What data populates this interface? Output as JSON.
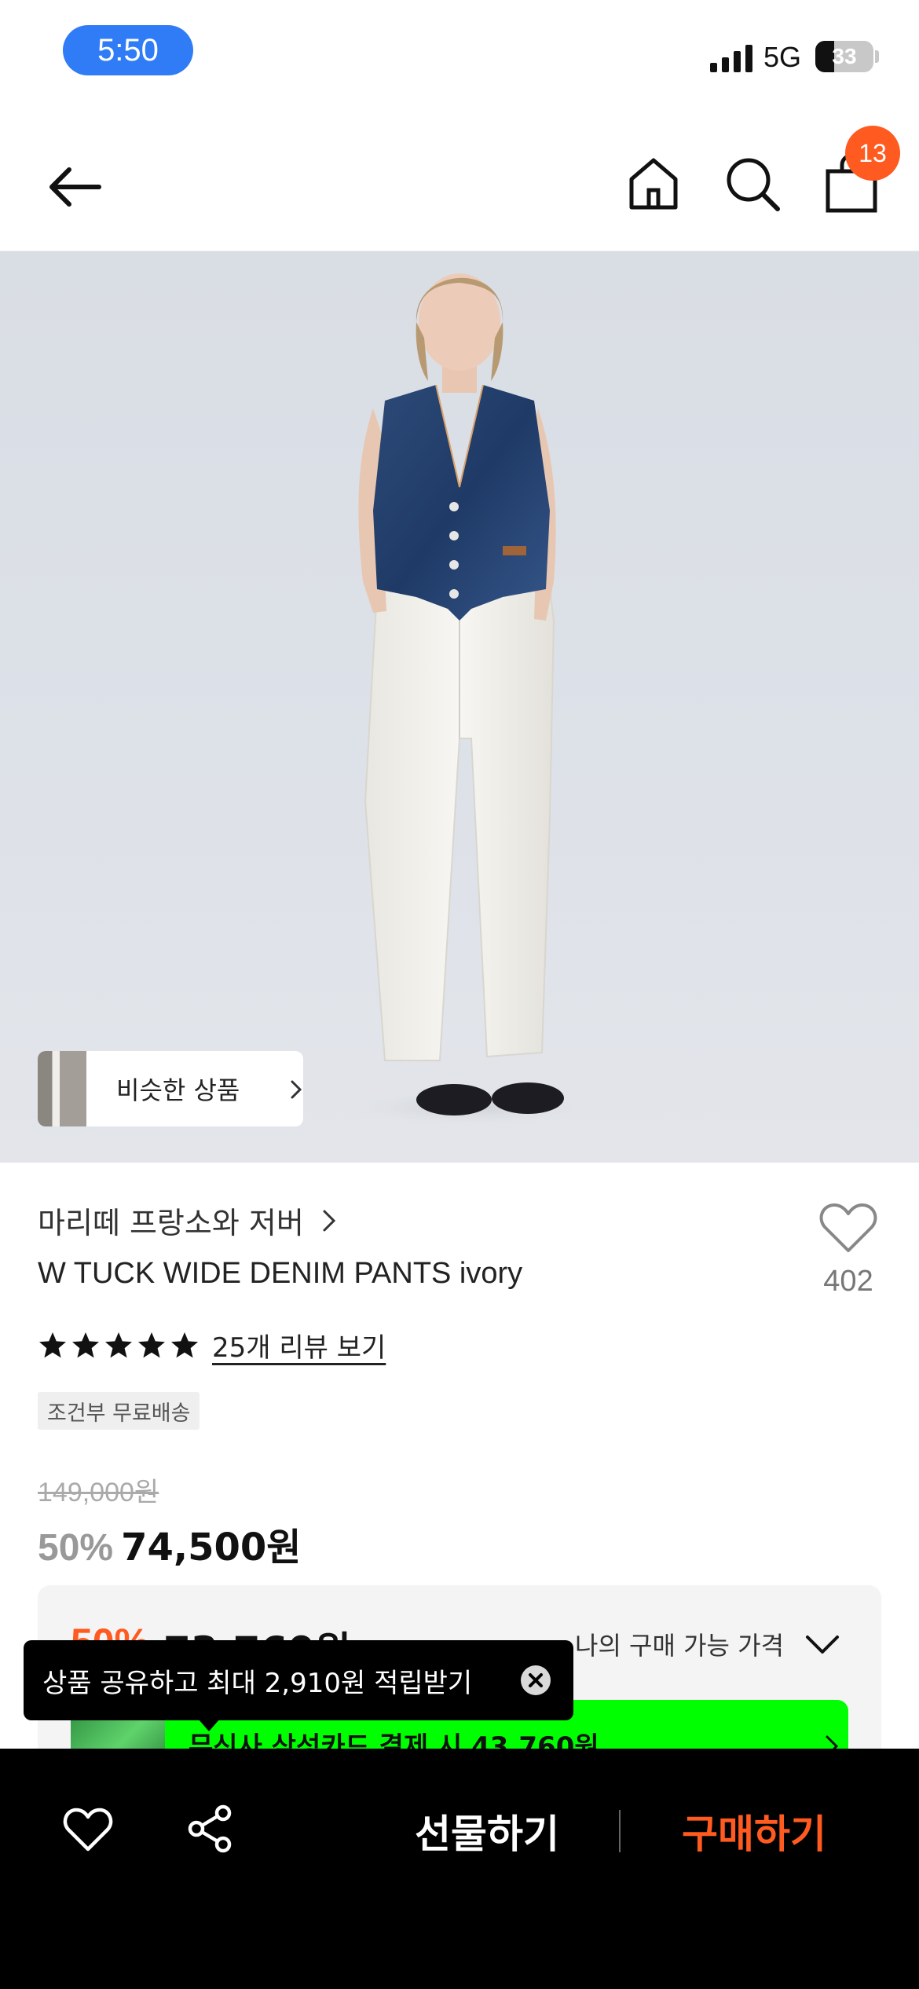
{
  "status_bar": {
    "time": "5:50",
    "network": "5G",
    "battery_percent": 33,
    "battery_label": "33"
  },
  "header": {
    "cart_count": "13",
    "icons": [
      "back-arrow-icon",
      "home-icon",
      "search-icon",
      "cart-bag-icon"
    ]
  },
  "hero": {
    "similar_label": "비슷한 상품"
  },
  "product": {
    "brand": "마리떼 프랑소와 저버",
    "name": "W TUCK WIDE DENIM PANTS ivory",
    "like_count": "402",
    "rating_stars": 5,
    "review_link": "25개 리뷰 보기",
    "shipping_tag": "조건부 무료배송",
    "original_price": "149,000원",
    "discount_rate": "50%",
    "sale_price": "74,500원"
  },
  "benefit": {
    "rate": "50%",
    "price": "73,760원",
    "label": "나의 구매 가능 가격",
    "card_text": "무신사 삼성카드 결제 시 43,760원"
  },
  "tooltip": {
    "text": "상품 공유하고 최대 2,910원 적립받기"
  },
  "bottom_bar": {
    "gift_label": "선물하기",
    "buy_label": "구매하기"
  },
  "colors": {
    "accent": "#ff5a1f",
    "card_banner": "#00ff00",
    "time_pill": "#2f7cf6"
  }
}
